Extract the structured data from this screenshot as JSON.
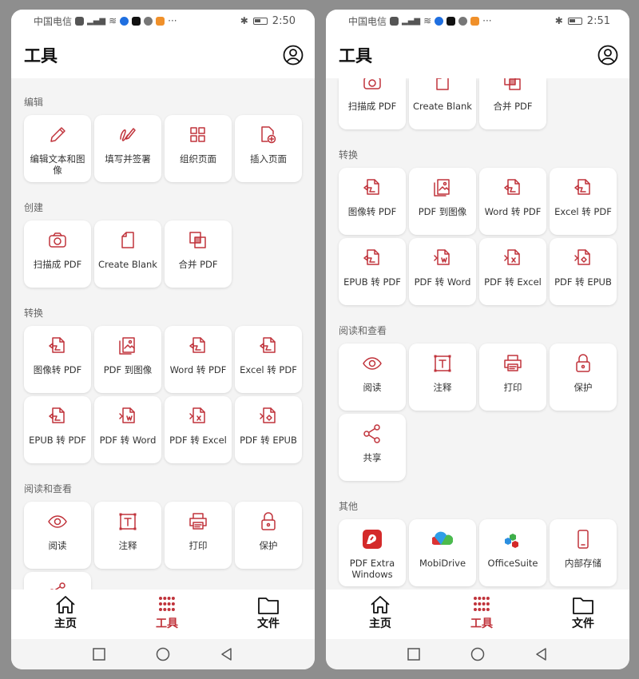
{
  "accent_color": "#c0333b",
  "phones": [
    {
      "status": {
        "carrier": "中国电信",
        "time": "2:50"
      },
      "header": {
        "title": "工具",
        "account_icon": "user-circle-icon"
      },
      "scroll": "top"
    },
    {
      "status": {
        "carrier": "中国电信",
        "time": "2:51"
      },
      "header": {
        "title": "工具",
        "account_icon": "user-circle-icon"
      },
      "scroll": "scrolled"
    }
  ],
  "sections": [
    {
      "label": "编辑",
      "tools": [
        {
          "label": "编辑文本和图像",
          "icon": "pencil"
        },
        {
          "label": "填写并签署",
          "icon": "sign"
        },
        {
          "label": "组织页面",
          "icon": "grid"
        },
        {
          "label": "插入页面",
          "icon": "page-plus"
        }
      ]
    },
    {
      "label": "创建",
      "tools": [
        {
          "label": "扫描成 PDF",
          "icon": "camera"
        },
        {
          "label": "Create Blank",
          "icon": "page"
        },
        {
          "label": "合并 PDF",
          "icon": "merge"
        }
      ]
    },
    {
      "label": "转换",
      "tools": [
        {
          "label": "图像转 PDF",
          "icon": "convert"
        },
        {
          "label": "PDF 到图像",
          "icon": "image"
        },
        {
          "label": "Word 转 PDF",
          "icon": "convert"
        },
        {
          "label": "Excel 转 PDF",
          "icon": "convert"
        },
        {
          "label": "EPUB 转 PDF",
          "icon": "convert"
        },
        {
          "label": "PDF 转 Word",
          "icon": "to-word"
        },
        {
          "label": "PDF 转 Excel",
          "icon": "to-excel"
        },
        {
          "label": "PDF 转 EPUB",
          "icon": "to-epub"
        }
      ]
    },
    {
      "label": "阅读和查看",
      "tools": [
        {
          "label": "阅读",
          "icon": "eye"
        },
        {
          "label": "注释",
          "icon": "text-box"
        },
        {
          "label": "打印",
          "icon": "printer"
        },
        {
          "label": "保护",
          "icon": "lock"
        },
        {
          "label": "共享",
          "icon": "share"
        }
      ]
    },
    {
      "label": "其他",
      "tools": [
        {
          "label": "PDF Extra Windows",
          "icon": "pdf-extra-logo"
        },
        {
          "label": "MobiDrive",
          "icon": "mobidrive-logo"
        },
        {
          "label": "OfficeSuite",
          "icon": "officesuite-logo"
        },
        {
          "label": "内部存储",
          "icon": "phone"
        }
      ]
    }
  ],
  "bottom_nav": [
    {
      "label": "主页",
      "icon": "home",
      "active": false
    },
    {
      "label": "工具",
      "icon": "dots-grid",
      "active": true
    },
    {
      "label": "文件",
      "icon": "folder",
      "active": false
    }
  ],
  "system_nav": [
    "recents-square-icon",
    "home-circle-icon",
    "back-triangle-icon"
  ]
}
